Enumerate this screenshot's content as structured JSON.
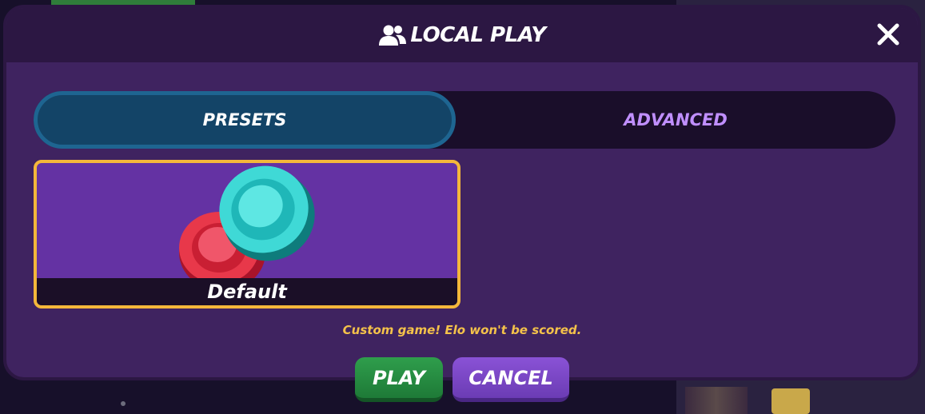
{
  "modal": {
    "title": "LOCAL PLAY",
    "title_icon": "users-icon",
    "close_icon": "close-icon"
  },
  "tabs": [
    {
      "label": "PRESETS",
      "active": true
    },
    {
      "label": "ADVANCED",
      "active": false
    }
  ],
  "presets": [
    {
      "label": "Default",
      "selected": true,
      "art": "checker-pieces-red-teal"
    }
  ],
  "notice": "Custom game! Elo won't be scored.",
  "buttons": {
    "play": "PLAY",
    "cancel": "CANCEL"
  },
  "colors": {
    "modal_bg": "#3f2360",
    "header_bg": "#2c1743",
    "tab_active_bg": "#134467",
    "tab_inactive_text": "#c08fff",
    "card_bg": "#6432a3",
    "card_border": "#f4b73a",
    "notice_text": "#f4c24a",
    "play_button": "#2f9e4c",
    "cancel_button": "#8a52d6"
  }
}
